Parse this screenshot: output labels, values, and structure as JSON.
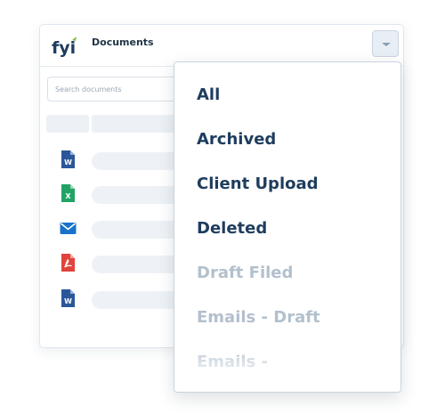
{
  "header": {
    "logo_text": "fyi",
    "title": "Documents"
  },
  "search": {
    "placeholder": "Search documents",
    "value": ""
  },
  "files": [
    {
      "icon": "word-doc-icon",
      "letter": "W",
      "color": "#2b579a"
    },
    {
      "icon": "excel-doc-icon",
      "letter": "X",
      "color": "#21a366"
    },
    {
      "icon": "email-icon",
      "letter": "",
      "color": "#1a73c9"
    },
    {
      "icon": "pdf-doc-icon",
      "letter": "",
      "color": "#e0443b"
    },
    {
      "icon": "word-doc-icon",
      "letter": "W",
      "color": "#2b579a"
    }
  ],
  "menu": {
    "items": [
      {
        "label": "All",
        "state": "active"
      },
      {
        "label": "Archived",
        "state": "active"
      },
      {
        "label": "Client Upload",
        "state": "active"
      },
      {
        "label": "Deleted",
        "state": "active"
      },
      {
        "label": "Draft Filed",
        "state": "muted"
      },
      {
        "label": "Emails - Draft",
        "state": "muted"
      },
      {
        "label": "Emails -",
        "state": "muted"
      }
    ]
  },
  "colors": {
    "menu_text": "#1e3d5e",
    "menu_text_muted": "#b3c0cd",
    "logo_green": "#7cc242"
  }
}
